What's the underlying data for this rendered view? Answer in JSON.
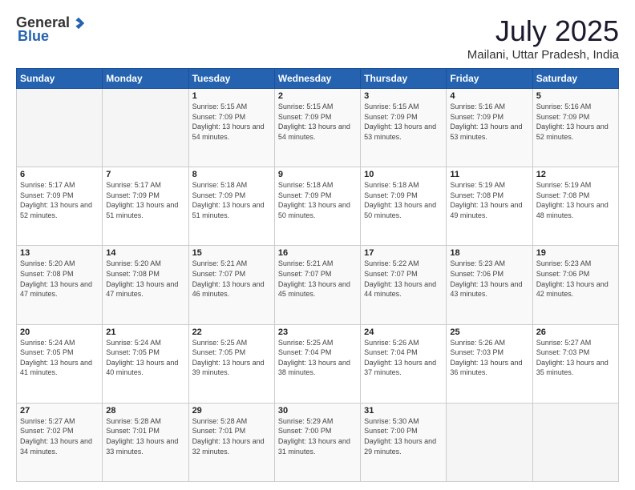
{
  "logo": {
    "general": "General",
    "blue": "Blue"
  },
  "title": "July 2025",
  "location": "Mailani, Uttar Pradesh, India",
  "days_of_week": [
    "Sunday",
    "Monday",
    "Tuesday",
    "Wednesday",
    "Thursday",
    "Friday",
    "Saturday"
  ],
  "weeks": [
    [
      {
        "day": "",
        "sunrise": "",
        "sunset": "",
        "daylight": ""
      },
      {
        "day": "",
        "sunrise": "",
        "sunset": "",
        "daylight": ""
      },
      {
        "day": "1",
        "sunrise": "Sunrise: 5:15 AM",
        "sunset": "Sunset: 7:09 PM",
        "daylight": "Daylight: 13 hours and 54 minutes."
      },
      {
        "day": "2",
        "sunrise": "Sunrise: 5:15 AM",
        "sunset": "Sunset: 7:09 PM",
        "daylight": "Daylight: 13 hours and 54 minutes."
      },
      {
        "day": "3",
        "sunrise": "Sunrise: 5:15 AM",
        "sunset": "Sunset: 7:09 PM",
        "daylight": "Daylight: 13 hours and 53 minutes."
      },
      {
        "day": "4",
        "sunrise": "Sunrise: 5:16 AM",
        "sunset": "Sunset: 7:09 PM",
        "daylight": "Daylight: 13 hours and 53 minutes."
      },
      {
        "day": "5",
        "sunrise": "Sunrise: 5:16 AM",
        "sunset": "Sunset: 7:09 PM",
        "daylight": "Daylight: 13 hours and 52 minutes."
      }
    ],
    [
      {
        "day": "6",
        "sunrise": "Sunrise: 5:17 AM",
        "sunset": "Sunset: 7:09 PM",
        "daylight": "Daylight: 13 hours and 52 minutes."
      },
      {
        "day": "7",
        "sunrise": "Sunrise: 5:17 AM",
        "sunset": "Sunset: 7:09 PM",
        "daylight": "Daylight: 13 hours and 51 minutes."
      },
      {
        "day": "8",
        "sunrise": "Sunrise: 5:18 AM",
        "sunset": "Sunset: 7:09 PM",
        "daylight": "Daylight: 13 hours and 51 minutes."
      },
      {
        "day": "9",
        "sunrise": "Sunrise: 5:18 AM",
        "sunset": "Sunset: 7:09 PM",
        "daylight": "Daylight: 13 hours and 50 minutes."
      },
      {
        "day": "10",
        "sunrise": "Sunrise: 5:18 AM",
        "sunset": "Sunset: 7:09 PM",
        "daylight": "Daylight: 13 hours and 50 minutes."
      },
      {
        "day": "11",
        "sunrise": "Sunrise: 5:19 AM",
        "sunset": "Sunset: 7:08 PM",
        "daylight": "Daylight: 13 hours and 49 minutes."
      },
      {
        "day": "12",
        "sunrise": "Sunrise: 5:19 AM",
        "sunset": "Sunset: 7:08 PM",
        "daylight": "Daylight: 13 hours and 48 minutes."
      }
    ],
    [
      {
        "day": "13",
        "sunrise": "Sunrise: 5:20 AM",
        "sunset": "Sunset: 7:08 PM",
        "daylight": "Daylight: 13 hours and 47 minutes."
      },
      {
        "day": "14",
        "sunrise": "Sunrise: 5:20 AM",
        "sunset": "Sunset: 7:08 PM",
        "daylight": "Daylight: 13 hours and 47 minutes."
      },
      {
        "day": "15",
        "sunrise": "Sunrise: 5:21 AM",
        "sunset": "Sunset: 7:07 PM",
        "daylight": "Daylight: 13 hours and 46 minutes."
      },
      {
        "day": "16",
        "sunrise": "Sunrise: 5:21 AM",
        "sunset": "Sunset: 7:07 PM",
        "daylight": "Daylight: 13 hours and 45 minutes."
      },
      {
        "day": "17",
        "sunrise": "Sunrise: 5:22 AM",
        "sunset": "Sunset: 7:07 PM",
        "daylight": "Daylight: 13 hours and 44 minutes."
      },
      {
        "day": "18",
        "sunrise": "Sunrise: 5:23 AM",
        "sunset": "Sunset: 7:06 PM",
        "daylight": "Daylight: 13 hours and 43 minutes."
      },
      {
        "day": "19",
        "sunrise": "Sunrise: 5:23 AM",
        "sunset": "Sunset: 7:06 PM",
        "daylight": "Daylight: 13 hours and 42 minutes."
      }
    ],
    [
      {
        "day": "20",
        "sunrise": "Sunrise: 5:24 AM",
        "sunset": "Sunset: 7:05 PM",
        "daylight": "Daylight: 13 hours and 41 minutes."
      },
      {
        "day": "21",
        "sunrise": "Sunrise: 5:24 AM",
        "sunset": "Sunset: 7:05 PM",
        "daylight": "Daylight: 13 hours and 40 minutes."
      },
      {
        "day": "22",
        "sunrise": "Sunrise: 5:25 AM",
        "sunset": "Sunset: 7:05 PM",
        "daylight": "Daylight: 13 hours and 39 minutes."
      },
      {
        "day": "23",
        "sunrise": "Sunrise: 5:25 AM",
        "sunset": "Sunset: 7:04 PM",
        "daylight": "Daylight: 13 hours and 38 minutes."
      },
      {
        "day": "24",
        "sunrise": "Sunrise: 5:26 AM",
        "sunset": "Sunset: 7:04 PM",
        "daylight": "Daylight: 13 hours and 37 minutes."
      },
      {
        "day": "25",
        "sunrise": "Sunrise: 5:26 AM",
        "sunset": "Sunset: 7:03 PM",
        "daylight": "Daylight: 13 hours and 36 minutes."
      },
      {
        "day": "26",
        "sunrise": "Sunrise: 5:27 AM",
        "sunset": "Sunset: 7:03 PM",
        "daylight": "Daylight: 13 hours and 35 minutes."
      }
    ],
    [
      {
        "day": "27",
        "sunrise": "Sunrise: 5:27 AM",
        "sunset": "Sunset: 7:02 PM",
        "daylight": "Daylight: 13 hours and 34 minutes."
      },
      {
        "day": "28",
        "sunrise": "Sunrise: 5:28 AM",
        "sunset": "Sunset: 7:01 PM",
        "daylight": "Daylight: 13 hours and 33 minutes."
      },
      {
        "day": "29",
        "sunrise": "Sunrise: 5:28 AM",
        "sunset": "Sunset: 7:01 PM",
        "daylight": "Daylight: 13 hours and 32 minutes."
      },
      {
        "day": "30",
        "sunrise": "Sunrise: 5:29 AM",
        "sunset": "Sunset: 7:00 PM",
        "daylight": "Daylight: 13 hours and 31 minutes."
      },
      {
        "day": "31",
        "sunrise": "Sunrise: 5:30 AM",
        "sunset": "Sunset: 7:00 PM",
        "daylight": "Daylight: 13 hours and 29 minutes."
      },
      {
        "day": "",
        "sunrise": "",
        "sunset": "",
        "daylight": ""
      },
      {
        "day": "",
        "sunrise": "",
        "sunset": "",
        "daylight": ""
      }
    ]
  ]
}
